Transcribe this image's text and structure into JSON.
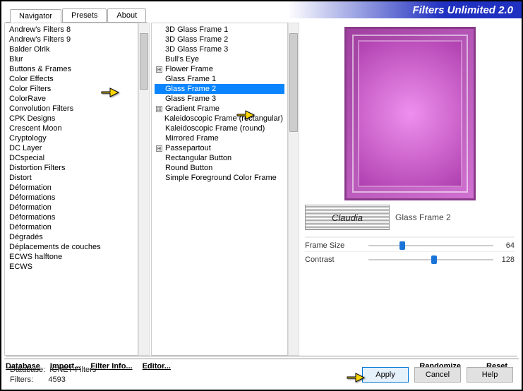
{
  "header": {
    "title": "Filters Unlimited 2.0"
  },
  "tabs": [
    "Navigator",
    "Presets",
    "About"
  ],
  "left_list": [
    "Andrew's Filters 8",
    "Andrew's Filters 9",
    "Balder Olrik",
    "Blur",
    "Buttons & Frames",
    "Color Effects",
    "Color Filters",
    "ColorRave",
    "Convolution Filters",
    "CPK Designs",
    "Crescent Moon",
    "Cryptology",
    "DC Layer",
    "DCspecial",
    "Distortion Filters",
    "Distort",
    "Déformation",
    "Déformations",
    "Déformation",
    "Déformations",
    "Déformation",
    "Dégradés",
    "Déplacements de couches",
    "ECWS halftone",
    "ECWS"
  ],
  "middle_list": [
    {
      "label": "3D Glass Frame 1",
      "exp": false
    },
    {
      "label": "3D Glass Frame 2",
      "exp": false
    },
    {
      "label": "3D Glass Frame 3",
      "exp": false
    },
    {
      "label": "Bull's Eye",
      "exp": false
    },
    {
      "label": "Flower Frame",
      "exp": true
    },
    {
      "label": "Glass Frame 1",
      "exp": false
    },
    {
      "label": "Glass Frame 2",
      "exp": false,
      "selected": true
    },
    {
      "label": "Glass Frame 3",
      "exp": false
    },
    {
      "label": "Gradient Frame",
      "exp": true
    },
    {
      "label": "Kaleidoscopic Frame (rectangular)",
      "exp": false
    },
    {
      "label": "Kaleidoscopic Frame (round)",
      "exp": false
    },
    {
      "label": "Mirrored Frame",
      "exp": false
    },
    {
      "label": "Passepartout",
      "exp": true
    },
    {
      "label": "Rectangular Button",
      "exp": false
    },
    {
      "label": "Round Button",
      "exp": false
    },
    {
      "label": "Simple Foreground Color Frame",
      "exp": false
    }
  ],
  "preview": {
    "filter_name": "Glass Frame 2",
    "watermark_text": "Claudia"
  },
  "sliders": [
    {
      "label": "Frame Size",
      "value": 64,
      "pos": 25
    },
    {
      "label": "Contrast",
      "value": 128,
      "pos": 50
    }
  ],
  "mid_buttons": {
    "left": [
      "Database",
      "Import...",
      "Filter Info...",
      "Editor..."
    ],
    "right": [
      "Randomize",
      "Reset"
    ]
  },
  "status": {
    "db_label": "Database:",
    "db_value": "ICNET-Filters",
    "filt_label": "Filters:",
    "filt_value": "4593"
  },
  "bottom_buttons": [
    "Apply",
    "Cancel",
    "Help"
  ]
}
